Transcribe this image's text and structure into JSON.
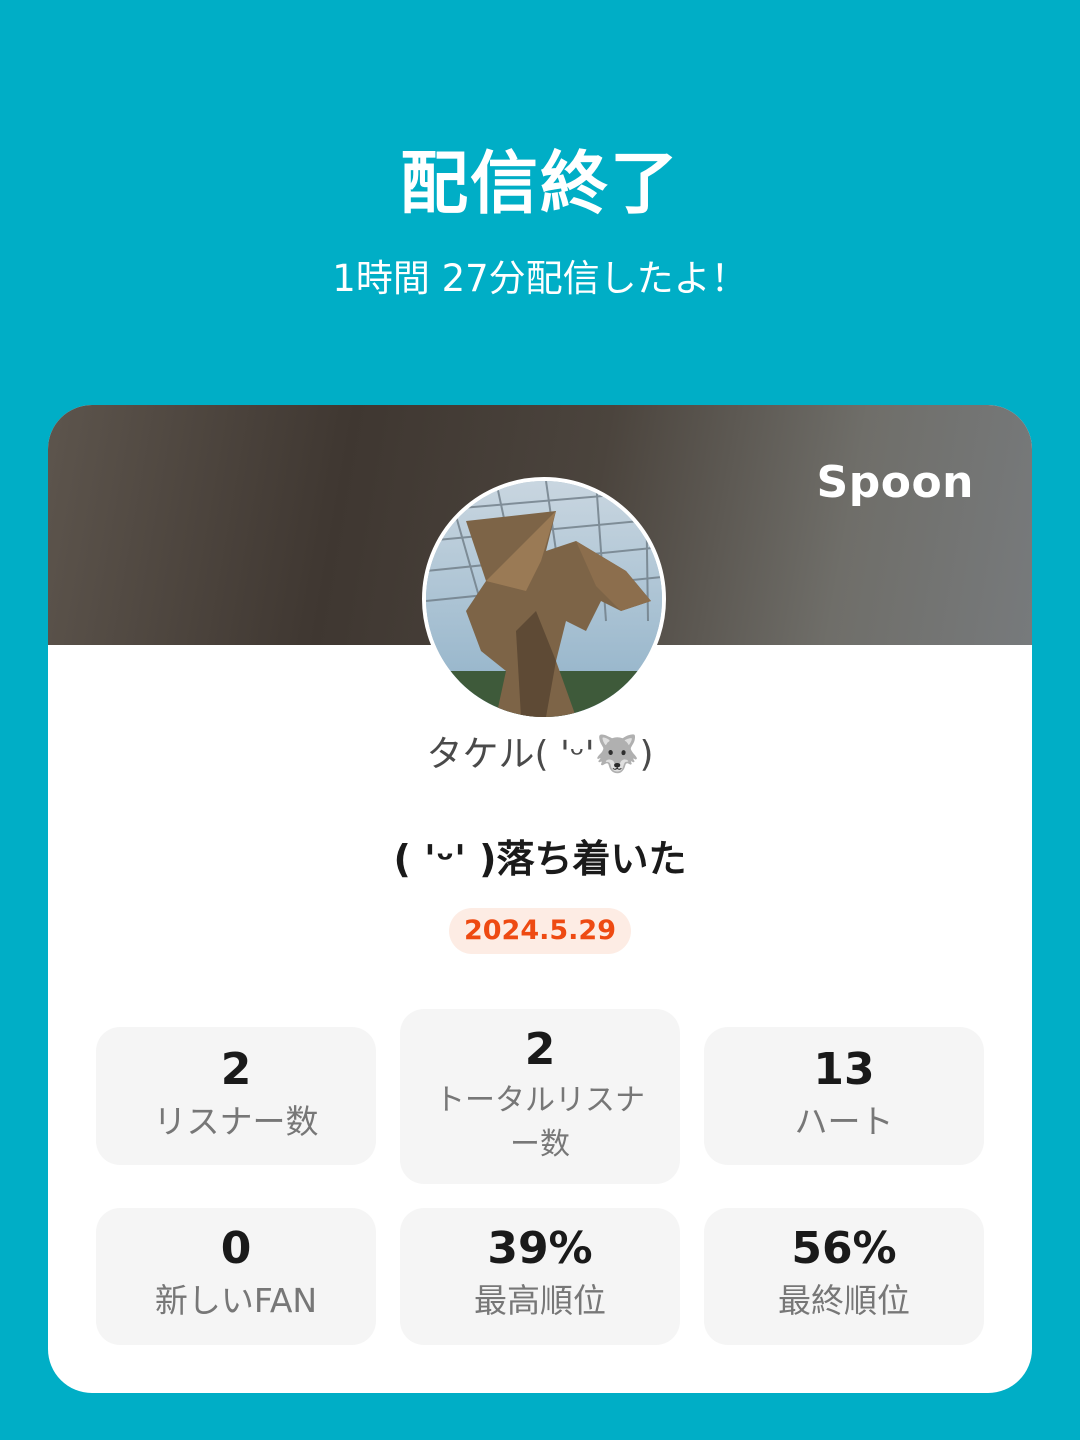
{
  "header": {
    "title": "配信終了",
    "subtitle": "1時間 27分配信したよ！"
  },
  "card": {
    "brand": "Spoon",
    "avatar_icon": "dragon-sculpture-photo",
    "username": "タケル( 'ᵕ'🐺)",
    "live_title": "(  'ᵕ' )落ち着いた",
    "date": "2024.5.29",
    "colors": {
      "background": "#00aec6",
      "date_text": "#ee4a12",
      "date_badge": "#fdece4"
    }
  },
  "stats": [
    {
      "value": "2",
      "label": "リスナー数"
    },
    {
      "value": "2",
      "label_line1": "トータルリスナ",
      "label_line2": "ー数"
    },
    {
      "value": "13",
      "label": "ハート"
    },
    {
      "value": "0",
      "label": "新しいFAN"
    },
    {
      "value": "39%",
      "label": "最高順位"
    },
    {
      "value": "56%",
      "label": "最終順位"
    }
  ]
}
